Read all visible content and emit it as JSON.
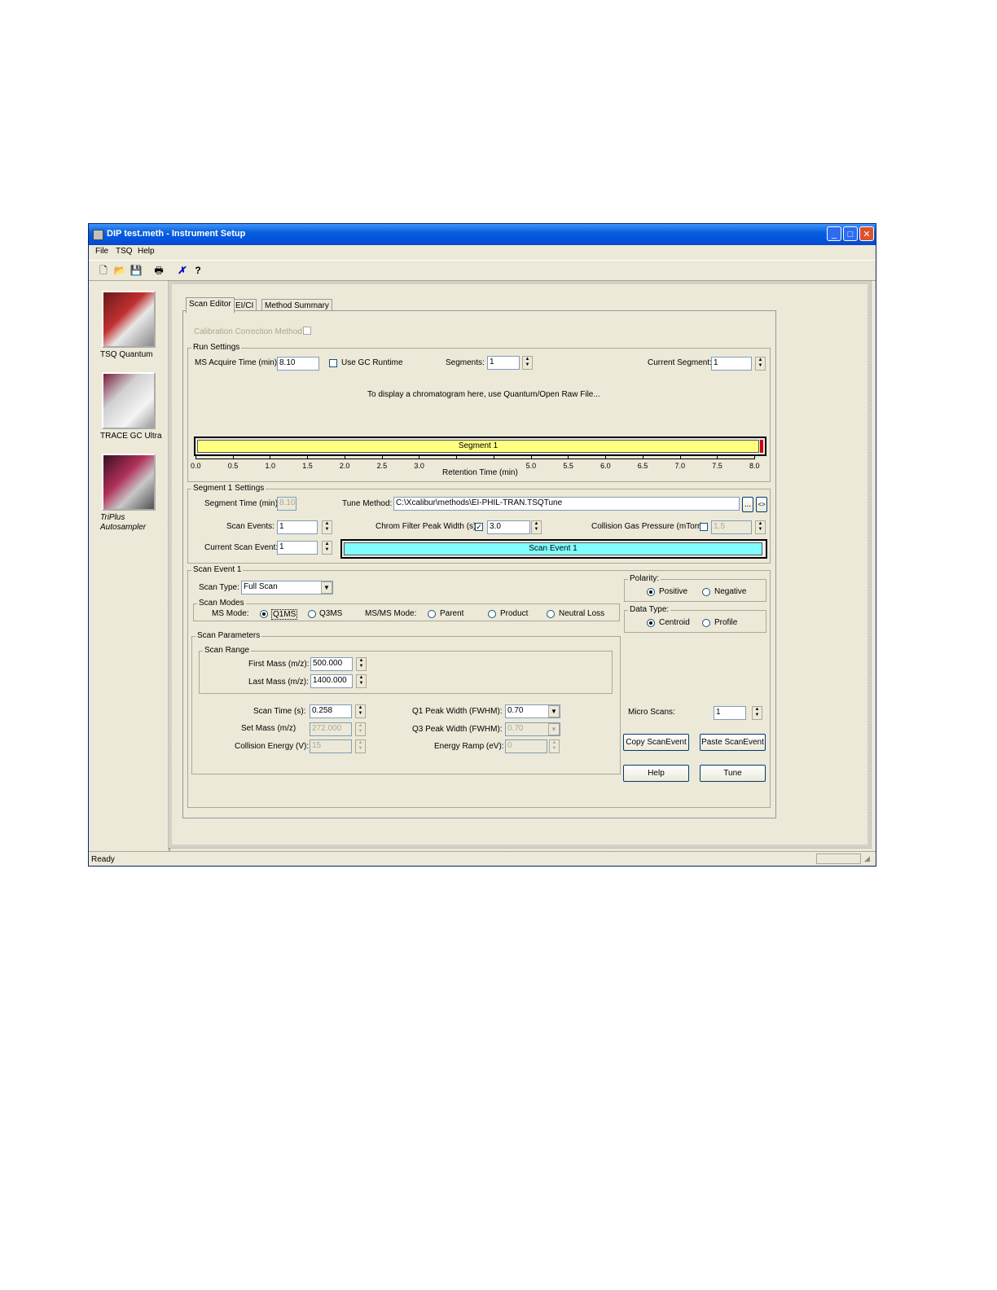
{
  "window": {
    "title": "DIP test.meth - Instrument Setup"
  },
  "menu": {
    "file": "File",
    "tsq": "TSQ",
    "help": "Help"
  },
  "toolbar": {
    "new_icon": "new-document-icon",
    "open_icon": "open-folder-icon",
    "save_icon": "save-icon",
    "print_icon": "printer-icon",
    "cut_icon": "cut-icon",
    "help_icon": "help-icon"
  },
  "instruments": [
    {
      "label": "TSQ Quantum"
    },
    {
      "label": "TRACE GC Ultra"
    },
    {
      "label_line1": "TriPlus",
      "label_line2": "Autosampler"
    }
  ],
  "tabs": [
    "Scan Editor",
    "EI/CI",
    "Method Summary"
  ],
  "calibration": {
    "label": "Calibration Correction Method"
  },
  "run_settings": {
    "title": "Run Settings",
    "ms_acquire_label": "MS Acquire Time (min):",
    "ms_acquire_value": "8.10",
    "use_gc_runtime": "Use GC Runtime",
    "segments_label": "Segments:",
    "segments_value": "1",
    "current_segment_label": "Current Segment:",
    "current_segment_value": "1",
    "chromatogram_msg": "To display a chromatogram here, use Quantum/Open Raw File...",
    "segment_bar_label": "Segment 1",
    "axis_label": "Retention Time (min)",
    "ticks": [
      "0.0",
      "0.5",
      "1.0",
      "1.5",
      "2.0",
      "2.5",
      "3.0",
      "",
      "",
      "5.0",
      "5.5",
      "6.0",
      "6.5",
      "7.0",
      "7.5",
      "8.0"
    ]
  },
  "segment_settings": {
    "title": "Segment 1 Settings",
    "segment_time_label": "Segment Time (min):",
    "segment_time_value": "8.10",
    "tune_method_label": "Tune Method:",
    "tune_method_value": "C:\\Xcalibur\\methods\\EI-PHIL-TRAN.TSQTune",
    "browse_label": "...",
    "arrow_label": "<>",
    "scan_events_label": "Scan Events:",
    "scan_events_value": "1",
    "chrom_filter_label": "Chrom Filter Peak Width (s):",
    "chrom_filter_value": "3.0",
    "collision_gas_label": "Collision Gas Pressure (mTorr):",
    "collision_gas_value": "1.5",
    "current_scan_event_label": "Current Scan Event:",
    "current_scan_event_value": "1",
    "scan_event_bar_label": "Scan Event 1"
  },
  "scan_event": {
    "title": "Scan Event 1",
    "scan_type_label": "Scan Type:",
    "scan_type_value": "Full Scan",
    "scan_modes_title": "Scan Modes",
    "ms_mode_label": "MS Mode:",
    "q1ms": "Q1MS",
    "q3ms": "Q3MS",
    "msms_mode_label": "MS/MS Mode:",
    "parent": "Parent",
    "product": "Product",
    "neutral_loss": "Neutral Loss",
    "polarity_title": "Polarity:",
    "positive": "Positive",
    "negative": "Negative",
    "data_type_title": "Data Type:",
    "centroid": "Centroid",
    "profile": "Profile",
    "scan_parameters_title": "Scan Parameters",
    "scan_range_title": "Scan Range",
    "first_mass_label": "First Mass (m/z):",
    "first_mass_value": "500.000",
    "last_mass_label": "Last Mass (m/z):",
    "last_mass_value": "1400.000",
    "scan_time_label": "Scan Time (s):",
    "scan_time_value": "0.258",
    "set_mass_label": "Set Mass (m/z)",
    "set_mass_value": "272.000",
    "collision_energy_label": "Collision Energy (V):",
    "collision_energy_value": "15",
    "q1_peak_label": "Q1 Peak Width (FWHM):",
    "q1_peak_value": "0.70",
    "q3_peak_label": "Q3 Peak Width (FWHM):",
    "q3_peak_value": "0.70",
    "energy_ramp_label": "Energy Ramp (eV):",
    "energy_ramp_value": "0",
    "micro_scans_label": "Micro Scans:",
    "micro_scans_value": "1",
    "copy_btn": "Copy ScanEvent",
    "paste_btn": "Paste ScanEvent",
    "help_btn": "Help",
    "tune_btn": "Tune"
  },
  "status": {
    "text": "Ready"
  }
}
